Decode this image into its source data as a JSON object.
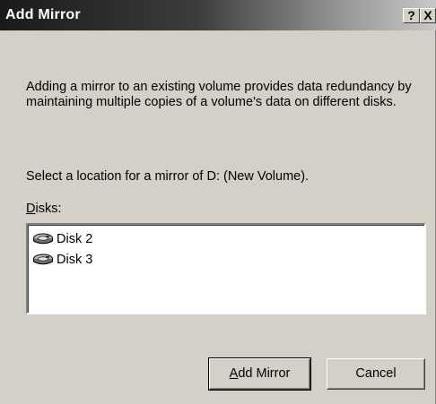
{
  "window": {
    "title": "Add Mirror",
    "help_label": "?",
    "close_label": "X"
  },
  "content": {
    "description": "Adding a mirror to an existing volume provides data redundancy by maintaining multiple copies of a volume's data on different disks.",
    "select_prompt": "Select a location for a mirror of D: (New Volume).",
    "disks_label_mnemonic": "D",
    "disks_label_rest": "isks:"
  },
  "disks": {
    "items": [
      {
        "label": "Disk 2",
        "icon": "disk-drive-icon"
      },
      {
        "label": "Disk 3",
        "icon": "disk-drive-icon"
      }
    ]
  },
  "buttons": {
    "add_mnemonic": "A",
    "add_rest": "dd Mirror",
    "cancel_label": "Cancel"
  }
}
